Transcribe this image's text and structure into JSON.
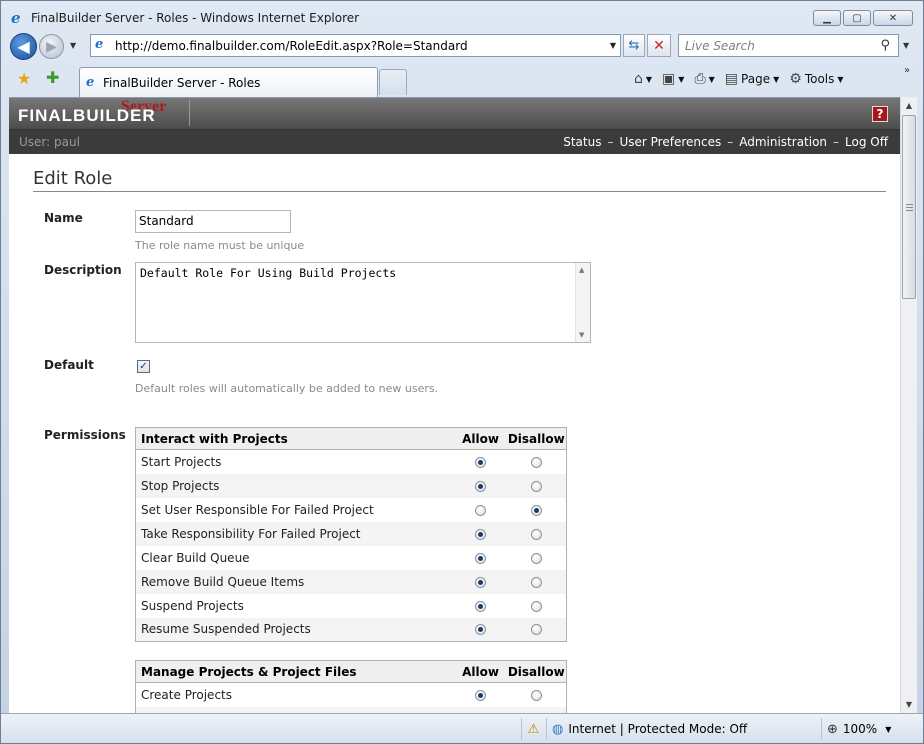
{
  "window": {
    "title": "FinalBuilder Server - Roles - Windows Internet Explorer",
    "minimize": "▁",
    "maximize": "▢",
    "close": "✕"
  },
  "browser": {
    "url": "http://demo.finalbuilder.com/RoleEdit.aspx?Role=Standard",
    "search_placeholder": "Live Search",
    "tab_label": "FinalBuilder Server - Roles",
    "commands": {
      "page": "Page",
      "tools": "Tools"
    }
  },
  "app": {
    "brand": "FINALBUILDER",
    "brand_server": "Server",
    "help": "?",
    "user_label": "User: paul",
    "nav": [
      "Status",
      "User Preferences",
      "Administration",
      "Log Off"
    ],
    "nav_separator": "–"
  },
  "form": {
    "page_title": "Edit Role",
    "name_label": "Name",
    "name_value": "Standard",
    "name_hint": "The role name must be unique",
    "description_label": "Description",
    "description_value": "Default Role For Using Build Projects",
    "default_label": "Default",
    "default_checked": true,
    "default_hint": "Default roles will automatically be added to new users.",
    "permissions_label": "Permissions"
  },
  "permission_groups": [
    {
      "title": "Interact with Projects",
      "allow_header": "Allow",
      "disallow_header": "Disallow",
      "rows": [
        {
          "label": "Start Projects",
          "allow": true
        },
        {
          "label": "Stop Projects",
          "allow": true
        },
        {
          "label": "Set User Responsible For Failed Project",
          "allow": false
        },
        {
          "label": "Take Responsibility For Failed Project",
          "allow": true
        },
        {
          "label": "Clear Build Queue",
          "allow": true
        },
        {
          "label": "Remove Build Queue Items",
          "allow": true
        },
        {
          "label": "Suspend Projects",
          "allow": true
        },
        {
          "label": "Resume Suspended Projects",
          "allow": true
        }
      ]
    },
    {
      "title": "Manage Projects & Project Files",
      "allow_header": "Allow",
      "disallow_header": "Disallow",
      "rows": [
        {
          "label": "Create Projects",
          "allow": true
        }
      ]
    }
  ],
  "status": {
    "zone": "Internet | Protected Mode: Off",
    "zoom": "100%"
  }
}
